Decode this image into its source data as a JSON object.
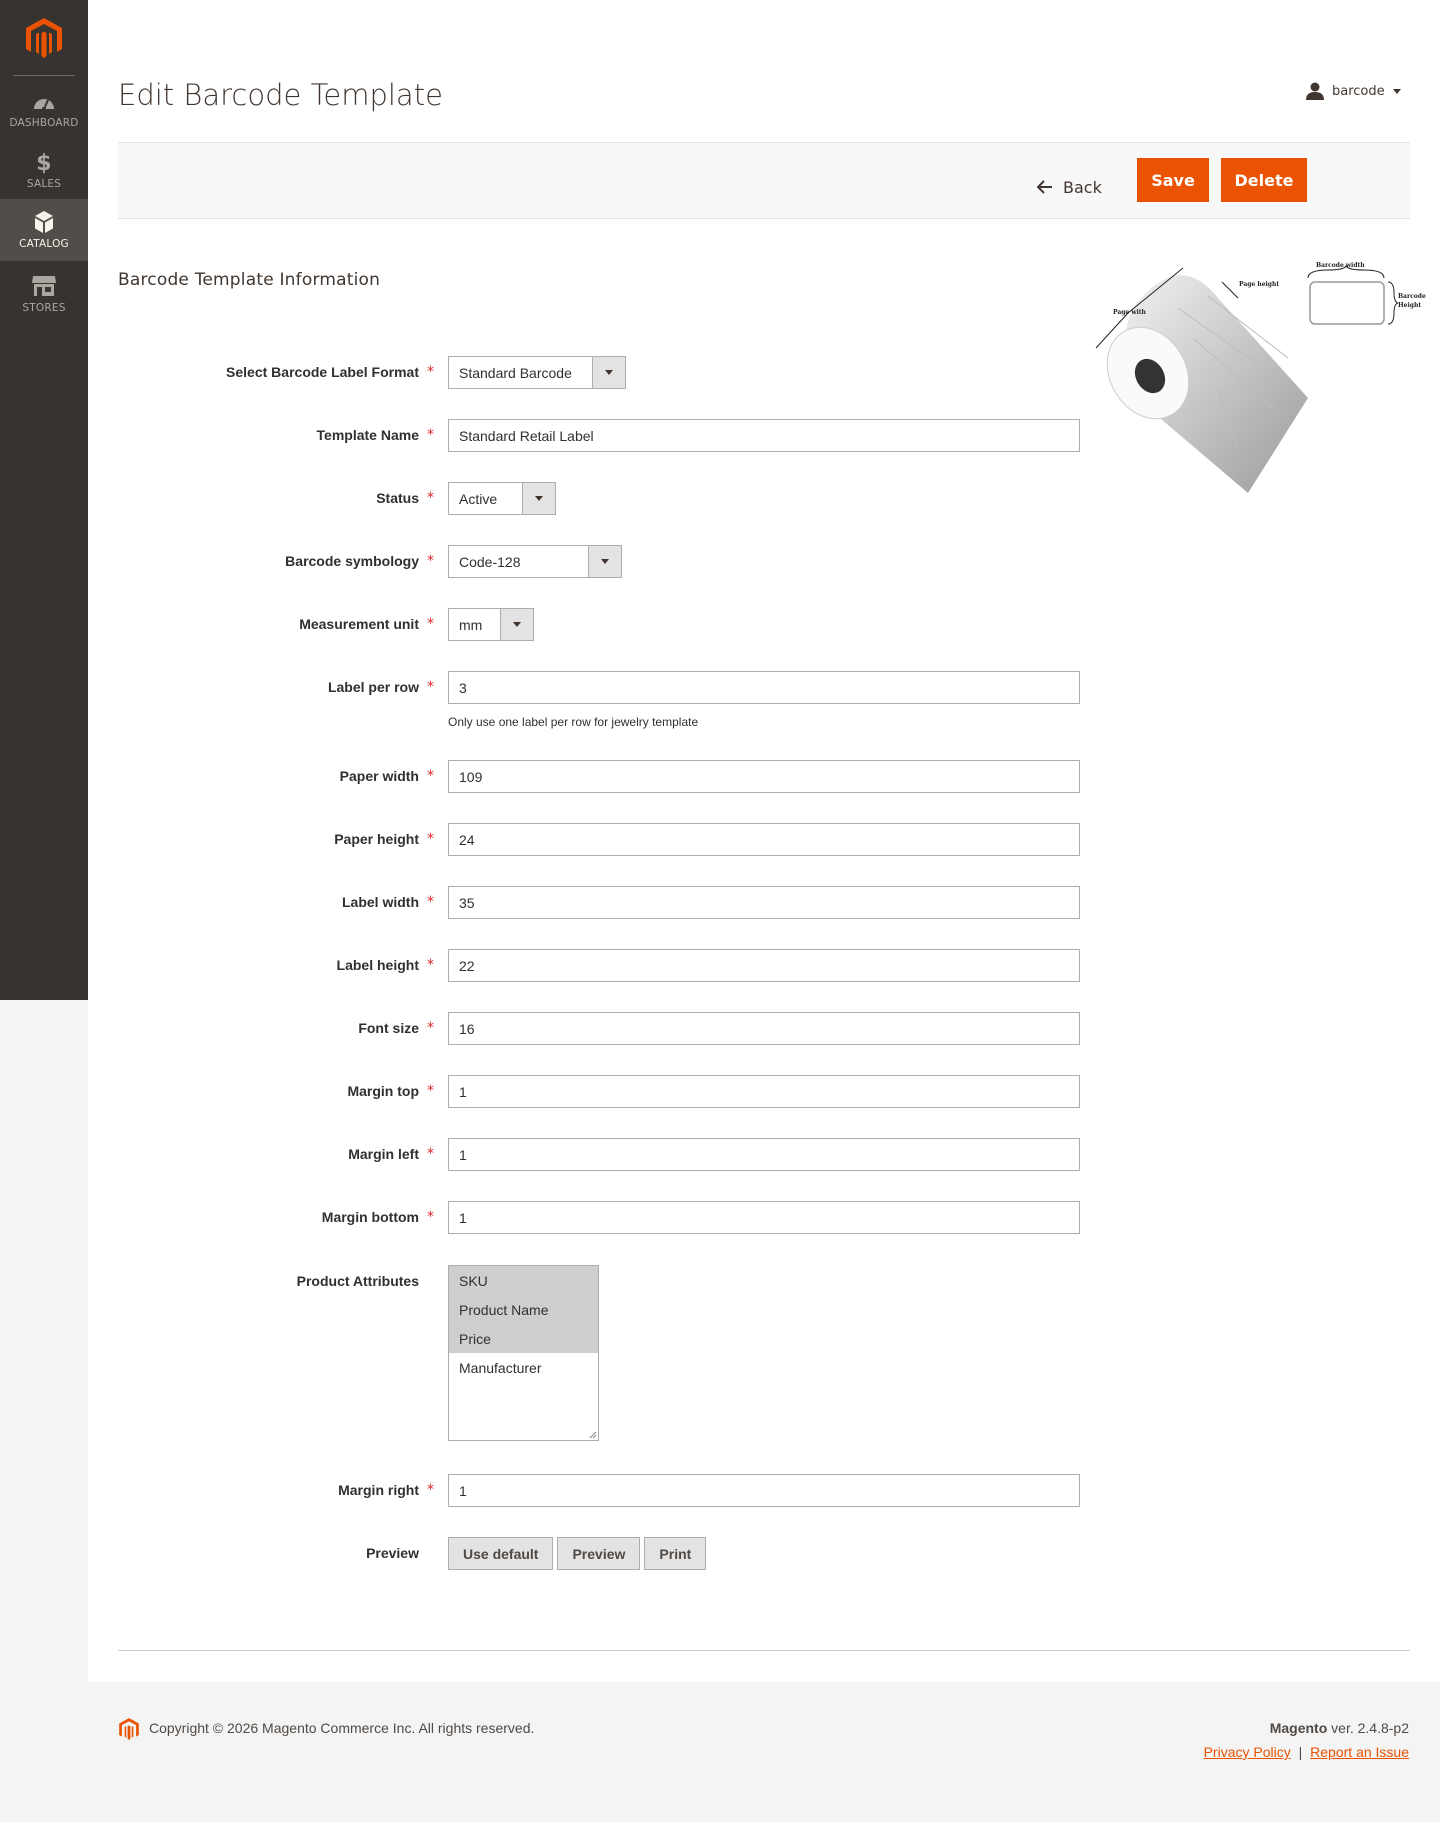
{
  "sidebar": {
    "logo_icon": "magento-logo-icon",
    "items": [
      {
        "label": "DASHBOARD",
        "icon": "dashboard-icon"
      },
      {
        "label": "SALES",
        "icon": "dollar-icon"
      },
      {
        "label": "CATALOG",
        "icon": "box-icon",
        "active": true
      },
      {
        "label": "STORES",
        "icon": "store-icon"
      }
    ]
  },
  "header": {
    "title": "Edit Barcode Template",
    "user": "barcode"
  },
  "actions": {
    "back": "Back",
    "save": "Save",
    "delete": "Delete"
  },
  "section": {
    "title": "Barcode Template Information"
  },
  "illustration": {
    "page_width": "Page with",
    "page_height": "Page height",
    "barcode_width": "Barcode width",
    "barcode_height_1": "Barcode",
    "barcode_height_2": "Height"
  },
  "form": {
    "label_format": {
      "label": "Select Barcode Label Format",
      "value": "Standard Barcode"
    },
    "template_name": {
      "label": "Template Name",
      "value": "Standard Retail Label"
    },
    "status": {
      "label": "Status",
      "value": "Active"
    },
    "symbology": {
      "label": "Barcode symbology",
      "value": "Code-128"
    },
    "unit": {
      "label": "Measurement unit",
      "value": "mm"
    },
    "label_per_row": {
      "label": "Label per row",
      "value": "3",
      "note": "Only use one label per row for jewelry template"
    },
    "paper_width": {
      "label": "Paper width",
      "value": "109"
    },
    "paper_height": {
      "label": "Paper height",
      "value": "24"
    },
    "label_width": {
      "label": "Label width",
      "value": "35"
    },
    "label_height": {
      "label": "Label height",
      "value": "22"
    },
    "font_size": {
      "label": "Font size",
      "value": "16"
    },
    "margin_top": {
      "label": "Margin top",
      "value": "1"
    },
    "margin_left": {
      "label": "Margin left",
      "value": "1"
    },
    "margin_bottom": {
      "label": "Margin bottom",
      "value": "1"
    },
    "product_attributes": {
      "label": "Product Attributes",
      "options": [
        {
          "label": "SKU",
          "selected": true
        },
        {
          "label": "Product Name",
          "selected": true
        },
        {
          "label": "Price",
          "selected": true
        },
        {
          "label": "Manufacturer",
          "selected": false
        }
      ]
    },
    "margin_right": {
      "label": "Margin right",
      "value": "1"
    },
    "preview": {
      "label": "Preview",
      "use_default": "Use default",
      "preview": "Preview",
      "print": "Print"
    },
    "required_mark": "*"
  },
  "footer": {
    "copyright": "Copyright © 2026 Magento Commerce Inc. All rights reserved.",
    "brand": "Magento",
    "version": " ver. 2.4.8-p2",
    "privacy": "Privacy Policy",
    "separator": "|",
    "report": "Report an Issue"
  },
  "colors": {
    "accent": "#eb5202",
    "sidebar": "#373330",
    "required": "#e22626"
  }
}
